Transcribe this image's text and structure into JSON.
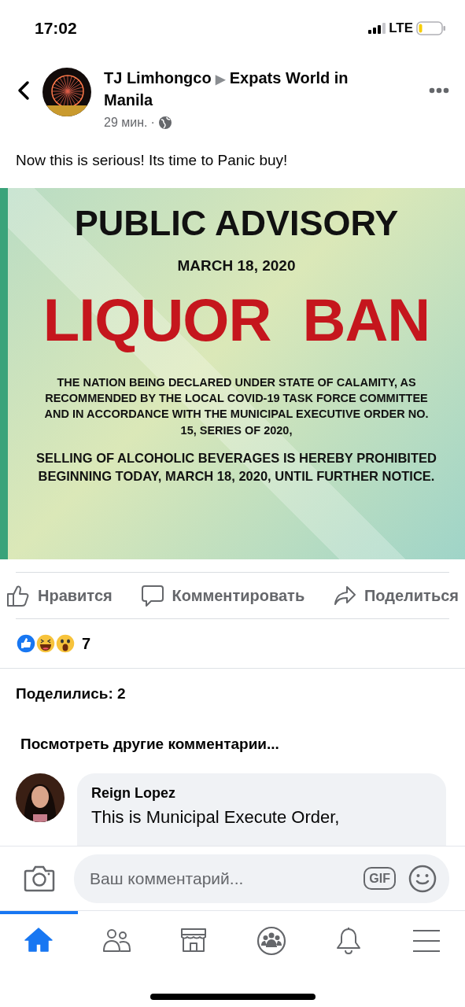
{
  "status_bar": {
    "time": "17:02",
    "network": "LTE"
  },
  "post": {
    "author": "TJ Limhongco",
    "group": "Expats World in Manila",
    "separator": "▶",
    "time": "29 мин.",
    "dot": "·",
    "text": "Now this is serious! Its time to Panic buy!",
    "image": {
      "kind": "poster",
      "title": "PUBLIC ADVISORY",
      "date": "MARCH 18, 2020",
      "headline": "LIQUOR  BAN",
      "paragraphs": [
        "THE NATION BEING DECLARED UNDER STATE OF CALAMITY, AS RECOMMENDED BY THE LOCAL COVID-19 TASK FORCE COMMITTEE AND IN ACCORDANCE WITH THE MUNICIPAL EXECUTIVE ORDER NO. 15, SERIES OF 2020,",
        "SELLING OF ALCOHOLIC BEVERAGES IS HEREBY PROHIBITED BEGINNING TODAY,  MARCH 18, 2020, UNTIL FURTHER NOTICE."
      ]
    }
  },
  "actions": [
    {
      "kind": "like",
      "label": "Нравится"
    },
    {
      "kind": "comment",
      "label": "Комментировать"
    },
    {
      "kind": "share",
      "label": "Поделиться"
    }
  ],
  "reactions": {
    "types": [
      {
        "kind": "like"
      },
      {
        "kind": "haha"
      },
      {
        "kind": "wow"
      }
    ],
    "count": "7"
  },
  "shares": "Поделились: 2",
  "more_comments": "Посмотреть другие комментарии...",
  "comments": [
    {
      "author": "Reign Lopez",
      "text": "This is Municipal Execute Order,"
    }
  ],
  "composer": {
    "placeholder": "Ваш комментарий...",
    "gif": "GIF"
  },
  "nav_tabs": [
    {
      "kind": "home",
      "selected": true
    },
    {
      "kind": "friends",
      "selected": false
    },
    {
      "kind": "marketplace",
      "selected": false
    },
    {
      "kind": "groups",
      "selected": false
    },
    {
      "kind": "notifications",
      "selected": false
    },
    {
      "kind": "menu",
      "selected": false
    }
  ]
}
